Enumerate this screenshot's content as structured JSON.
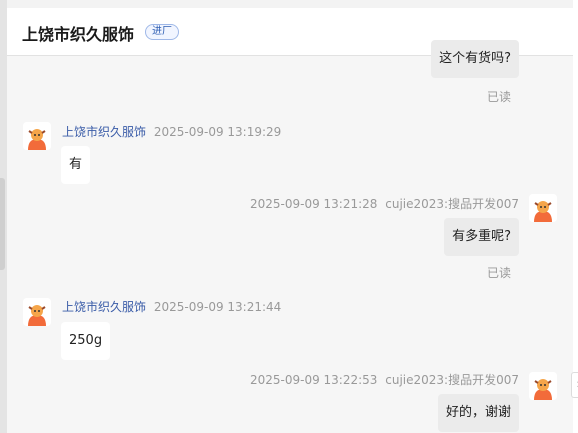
{
  "header": {
    "title": "上饶市织久服饰",
    "badge": "进厂"
  },
  "messages": [
    {
      "text": "这个有货吗?",
      "status": "已读"
    },
    {
      "sender": "上饶市织久服饰",
      "time": "2025-09-09 13:19:29",
      "text": "有"
    },
    {
      "time": "2025-09-09 13:21:28",
      "sender": "cujie2023:搜品开发007",
      "text": "有多重呢?",
      "status": "已读"
    },
    {
      "sender": "上饶市织久服饰",
      "time": "2025-09-09 13:21:44",
      "text": "250g"
    },
    {
      "time": "2025-09-09 13:22:53",
      "sender": "cujie2023:搜品开发007",
      "text": "好的，谢谢"
    }
  ],
  "icons": {
    "avatar": "yak-mascot-icon",
    "expand": "chevron-right-icon"
  }
}
